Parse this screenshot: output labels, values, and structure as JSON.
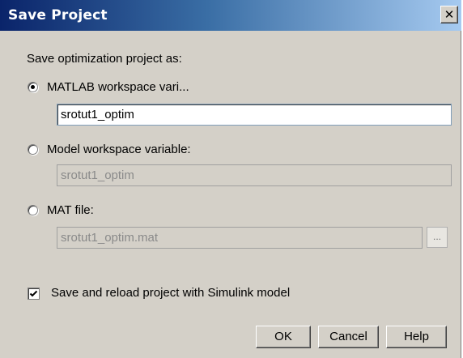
{
  "window": {
    "title": "Save Project",
    "close_glyph": "✕"
  },
  "prompt": "Save optimization project as:",
  "options": [
    {
      "label": "MATLAB workspace vari...",
      "value": "srotut1_optim",
      "selected": true,
      "enabled": true
    },
    {
      "label": "Model workspace variable:",
      "value": "srotut1_optim",
      "selected": false,
      "enabled": false
    },
    {
      "label": "MAT file:",
      "value": "srotut1_optim.mat",
      "selected": false,
      "enabled": false
    }
  ],
  "browse_label": "...",
  "checkbox": {
    "label": "Save and reload project with Simulink model",
    "checked": true
  },
  "buttons": {
    "ok": "OK",
    "cancel": "Cancel",
    "help": "Help"
  },
  "colors": {
    "title_bar_start": "#0a246a",
    "title_bar_end": "#a6caf0",
    "dialog_background": "#d4d0c8",
    "disabled_text": "#8a8a8a"
  },
  "icons": {
    "close": "close-icon",
    "checkmark": "checkmark-icon",
    "browse": "ellipsis-icon"
  }
}
